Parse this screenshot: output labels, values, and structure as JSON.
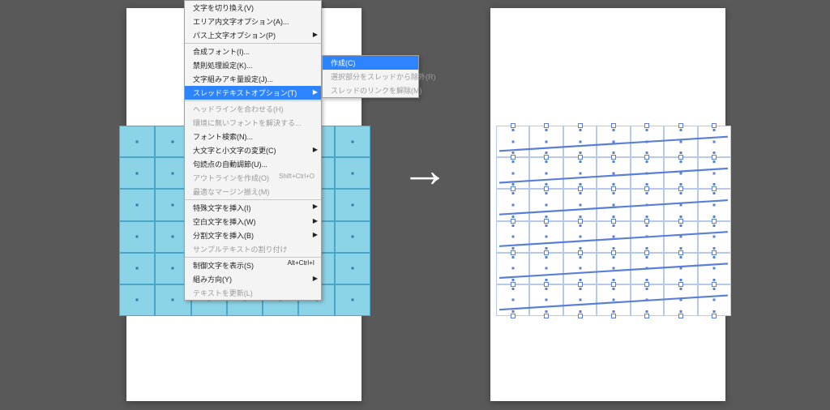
{
  "title": "Adobe Illustrator — Thread Text Options",
  "menu_main": {
    "items": [
      {
        "label": "文字を切り換え(V)"
      },
      {
        "label": "エリア内文字オプション(A)..."
      },
      {
        "label": "パス上文字オプション(P)",
        "has_sub": true
      },
      {
        "label": "合成フォント(I)...",
        "sep": true
      },
      {
        "label": "禁則処理設定(K)..."
      },
      {
        "label": "文字組みアキ量設定(J)..."
      },
      {
        "label": "スレッドテキストオプション(T)",
        "has_sub": true,
        "hover": true
      },
      {
        "label": "ヘッドラインを合わせる(H)",
        "sep": true,
        "disabled": true
      },
      {
        "label": "環境に無いフォントを解決する...",
        "disabled": true
      },
      {
        "label": "フォント検索(N)..."
      },
      {
        "label": "大文字と小文字の変更(C)",
        "has_sub": true
      },
      {
        "label": "句読点の自動調節(U)..."
      },
      {
        "label": "アウトラインを作成(O)",
        "disabled": true,
        "shortcut": "Shift+Ctrl+O"
      },
      {
        "label": "最適なマージン揃え(M)",
        "disabled": true
      },
      {
        "label": "特殊文字を挿入(I)",
        "sep": true,
        "has_sub": true
      },
      {
        "label": "空白文字を挿入(W)",
        "has_sub": true
      },
      {
        "label": "分割文字を挿入(B)",
        "has_sub": true
      },
      {
        "label": "サンプルテキストの割り付け",
        "disabled": true
      },
      {
        "label": "制御文字を表示(S)",
        "sep": true,
        "shortcut": "Alt+Ctrl+I"
      },
      {
        "label": "組み方向(Y)",
        "has_sub": true
      },
      {
        "label": "テキストを更新(L)",
        "disabled": true
      }
    ]
  },
  "menu_sub": {
    "items": [
      {
        "label": "作成(C)",
        "hover": true
      },
      {
        "label": "選択部分をスレッドから除外(R)",
        "disabled": true
      },
      {
        "label": "スレッドのリンクを解除(M)",
        "disabled": true
      }
    ]
  },
  "grid": {
    "rows": 6,
    "cols": 7
  },
  "colors": {
    "bg": "#595959",
    "paper": "#ffffff",
    "cell_fill": "#8bd3e6",
    "cell_border": "#4aa6c7",
    "thread": "#5a7fd6",
    "menu_hover": "#2e84ff"
  }
}
